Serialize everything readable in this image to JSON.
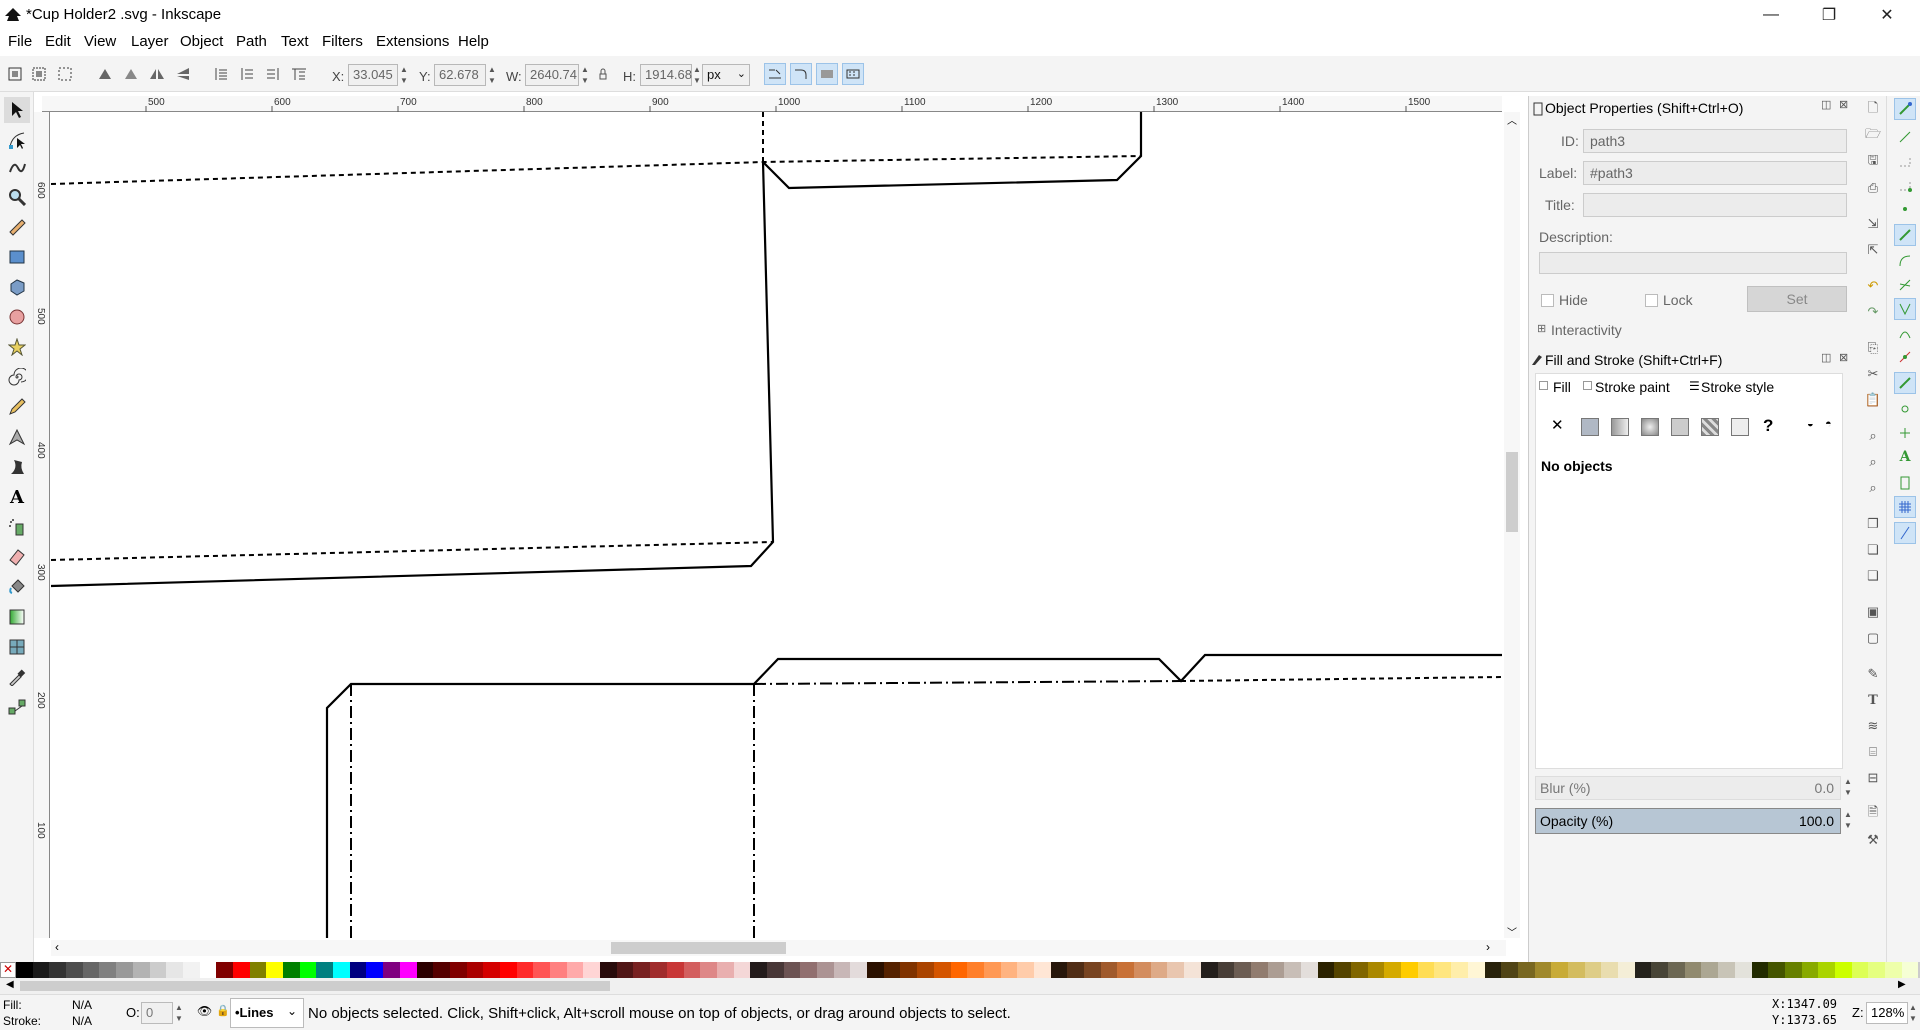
{
  "window": {
    "title": "*Cup Holder2 .svg - Inkscape",
    "minimize": "—",
    "maximize": "❐",
    "close": "✕"
  },
  "menu": [
    "File",
    "Edit",
    "View",
    "Layer",
    "Object",
    "Path",
    "Text",
    "Filters",
    "Extensions",
    "Help"
  ],
  "toolbar": {
    "x_label": "X:",
    "x_value": "33.045",
    "y_label": "Y:",
    "y_value": "62.678",
    "w_label": "W:",
    "w_value": "2640.74",
    "h_label": "H:",
    "h_value": "1914.68",
    "unit": "px"
  },
  "ruler": {
    "h_ticks": [
      "500",
      "600",
      "700",
      "800",
      "900",
      "1000",
      "1100",
      "1200",
      "1300",
      "1400",
      "1500"
    ],
    "v_ticks": [
      "600",
      "500",
      "400",
      "300",
      "200",
      "100"
    ]
  },
  "panel": {
    "object_properties": {
      "title": "Object Properties (Shift+Ctrl+O)",
      "id_label": "ID:",
      "id_value": "path3",
      "label_label": "Label:",
      "label_value": "#path3",
      "title_label": "Title:",
      "title_value": "",
      "description_label": "Description:",
      "hide_label": "Hide",
      "lock_label": "Lock",
      "set_label": "Set",
      "interactivity_label": "Interactivity"
    },
    "fill_stroke": {
      "title": "Fill and Stroke (Shift+Ctrl+F)",
      "tabs": [
        "Fill",
        "Stroke paint",
        "Stroke style"
      ],
      "no_objects": "No objects",
      "blur_label": "Blur (%)",
      "blur_value": "0.0",
      "opacity_label": "Opacity (%)",
      "opacity_value": "100.0",
      "opacity_fraction": 1.0
    }
  },
  "palette_colors": [
    "#000000",
    "#1a1a1a",
    "#333333",
    "#4d4d4d",
    "#666666",
    "#808080",
    "#999999",
    "#b3b3b3",
    "#cccccc",
    "#e6e6e6",
    "#f2f2f2",
    "#ffffff",
    "#800000",
    "#ff0000",
    "#808000",
    "#ffff00",
    "#008000",
    "#00ff00",
    "#008080",
    "#00ffff",
    "#000080",
    "#0000ff",
    "#800080",
    "#ff00ff",
    "#2b0000",
    "#550000",
    "#800000",
    "#aa0000",
    "#d40000",
    "#ff0000",
    "#ff2a2a",
    "#ff5555",
    "#ff8080",
    "#ffaaaa",
    "#ffd5d5",
    "#280b0b",
    "#501616",
    "#782121",
    "#a02c2c",
    "#c83737",
    "#d35f5f",
    "#de8787",
    "#e9afaf",
    "#f4d7d7",
    "#241c1c",
    "#483737",
    "#6c5353",
    "#916f6f",
    "#ac9393",
    "#c8b7b7",
    "#e3dbdb",
    "#2b1100",
    "#552200",
    "#803300",
    "#aa4400",
    "#d45500",
    "#ff6600",
    "#ff7f2a",
    "#ff9955",
    "#ffb380",
    "#ffccaa",
    "#ffe6d5",
    "#28170b",
    "#502d16",
    "#784421",
    "#a05a2c",
    "#c87137",
    "#d38d5f",
    "#deaa87",
    "#e9c6af",
    "#f4e3d7",
    "#241f1c",
    "#483e37",
    "#6c5d53",
    "#917c6f",
    "#ac9d93",
    "#c8beb7",
    "#e3dedb",
    "#2b2200",
    "#554400",
    "#806600",
    "#aa8800",
    "#d4aa00",
    "#ffcc00",
    "#ffdd55",
    "#ffe680",
    "#ffeeaa",
    "#fff6d5",
    "#28220b",
    "#504416",
    "#786721",
    "#a0892c",
    "#c8ab37",
    "#d3bc5f",
    "#decd87",
    "#e9ddaf",
    "#f4eed7",
    "#24221c",
    "#484537",
    "#6c6753",
    "#918a6f",
    "#aca793",
    "#c8c4b7",
    "#e3e2db",
    "#222b00",
    "#445500",
    "#668000",
    "#88aa00",
    "#aad400",
    "#ccff00",
    "#ddff55",
    "#e5ff80",
    "#eeffaa",
    "#f6ffd5"
  ],
  "status": {
    "fill_label": "Fill:",
    "fill_value": "N/A",
    "stroke_label": "Stroke:",
    "stroke_value": "N/A",
    "o_label": "O:",
    "o_value": "0",
    "layer": "•Lines",
    "message": "No objects selected. Click, Shift+click, Alt+scroll mouse on top of objects, or drag around objects to select.",
    "cursor_x": "X:1347.09",
    "cursor_y": "Y:1373.65",
    "zoom_label": "Z:",
    "zoom_value": "128%"
  }
}
